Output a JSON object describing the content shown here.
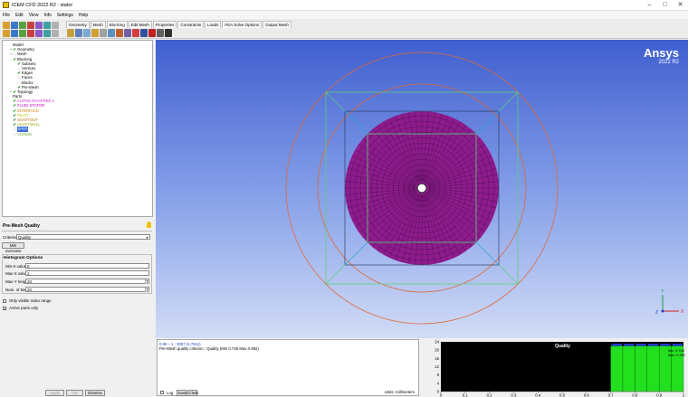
{
  "window": {
    "title": "ICEM CFD 2022 R2 : stator",
    "minimize": "–",
    "maximize": "□",
    "close": "✕"
  },
  "menu": [
    "File",
    "Edit",
    "View",
    "Info",
    "Settings",
    "Help"
  ],
  "tabs": [
    "Geometry",
    "Mesh",
    "Blocking",
    "Edit Mesh",
    "Properties",
    "Constraints",
    "Loads",
    "FEA Solve Options",
    "Output Mesh"
  ],
  "active_tab": "Blocking",
  "tree": [
    {
      "label": "Model",
      "indent": 0,
      "toggle": "-",
      "check": ""
    },
    {
      "label": "Geometry",
      "indent": 1,
      "toggle": "+",
      "check": "✔"
    },
    {
      "label": "Mesh",
      "indent": 1,
      "toggle": "+",
      "check": "□"
    },
    {
      "label": "Blocking",
      "indent": 1,
      "toggle": "-",
      "check": "✔"
    },
    {
      "label": "Subsets",
      "indent": 2,
      "toggle": "",
      "check": "✔"
    },
    {
      "label": "Vertices",
      "indent": 2,
      "toggle": "",
      "check": "□"
    },
    {
      "label": "Edges",
      "indent": 2,
      "toggle": "",
      "check": "✔"
    },
    {
      "label": "Faces",
      "indent": 2,
      "toggle": "",
      "check": "□"
    },
    {
      "label": "Blocks",
      "indent": 2,
      "toggle": "",
      "check": "□"
    },
    {
      "label": "Pre-Mesh",
      "indent": 2,
      "toggle": "",
      "check": "✔"
    },
    {
      "label": "Topology",
      "indent": 1,
      "toggle": "+",
      "check": "✔"
    },
    {
      "label": "Parts",
      "indent": 0,
      "toggle": "-",
      "check": ""
    },
    {
      "label": "CURVE.MAGFREE.1",
      "indent": 1,
      "toggle": "",
      "check": "✔",
      "color": "#d030d0"
    },
    {
      "label": "FLUID.STATOR",
      "indent": 1,
      "toggle": "",
      "check": "✔",
      "color": "#c000c0"
    },
    {
      "label": "INTERFACE",
      "indent": 1,
      "toggle": "",
      "check": "✔",
      "color": "#d08000"
    },
    {
      "label": "PILOT",
      "indent": 1,
      "toggle": "",
      "check": "✔",
      "color": "#c0c000"
    },
    {
      "label": "SHAFTOUT",
      "indent": 1,
      "toggle": "",
      "check": "✔",
      "color": "#c07000"
    },
    {
      "label": "SHAFTWALL",
      "indent": 1,
      "toggle": "",
      "check": "✔",
      "color": "#a0b000"
    },
    {
      "label": "STAT",
      "indent": 1,
      "toggle": "",
      "check": "□",
      "color": "#1040c0",
      "selected": true
    },
    {
      "label": "VDOMN",
      "indent": 1,
      "toggle": "",
      "check": "□",
      "color": "#70b040"
    }
  ],
  "panel": {
    "title": "Pre-Mesh Quality",
    "criterion_label": "Criterion",
    "criterion_value": "Quality",
    "min_overview": "Min overview",
    "histogram_title": "Histogram Options",
    "fields": [
      {
        "label": "Min-X value",
        "value": "0"
      },
      {
        "label": "Max-X value",
        "value": "1"
      },
      {
        "label": "Max-Y height",
        "value": "20"
      },
      {
        "label": "Num. of bars",
        "value": "20"
      }
    ],
    "only_visible": "Only visible index range",
    "only_visible_checked": false,
    "active_parts": "Active parts only",
    "active_parts_checked": true,
    "apply": "Apply",
    "ok": "OK",
    "dismiss": "Dismiss"
  },
  "brand": {
    "name": "Ansys",
    "version": "2022 R2"
  },
  "axes": {
    "x": "X",
    "y": "Y",
    "z": "Z"
  },
  "messages": [
    "0.95 – 1 : 3007 (4.7511)",
    "Pre-Mesh quality criterion : Quality  (Min 0.746  Max 0.992)"
  ],
  "msg_footer": {
    "log": "Log",
    "save": "Save",
    "clear": "Clear",
    "units": "Units: millimeters"
  },
  "colors": {
    "viewport_top": "#3f5fd0",
    "mesh": "#8e1c8e",
    "hist_bar": "#22e01e",
    "block": "#5ad07a",
    "curve": "#e06838"
  },
  "chart_data": {
    "type": "bar",
    "title": "Quality",
    "x": [
      0.7,
      0.75,
      0.8,
      0.85,
      0.9,
      0.95
    ],
    "values": [
      22,
      22,
      22,
      22,
      22,
      22
    ],
    "bar_width": 0.05,
    "xlim": [
      0,
      1
    ],
    "ylim": [
      0,
      24
    ],
    "yticks": [
      0,
      4,
      8,
      12,
      16,
      20,
      24
    ],
    "xticks": [
      0,
      0.1,
      0.2,
      0.3,
      0.4,
      0.5,
      0.6,
      0.7,
      0.8,
      0.9,
      1
    ],
    "xticklabels": [
      "0",
      "0.1",
      "0.2",
      "0.3",
      "0.4",
      "0.5",
      "0.6",
      "0.7",
      "0.8",
      "0.9",
      "1"
    ],
    "annotations": [
      {
        "label": "Min: 0.746"
      },
      {
        "label": "Max: 0.992"
      }
    ],
    "grid": false,
    "legend": "none"
  }
}
